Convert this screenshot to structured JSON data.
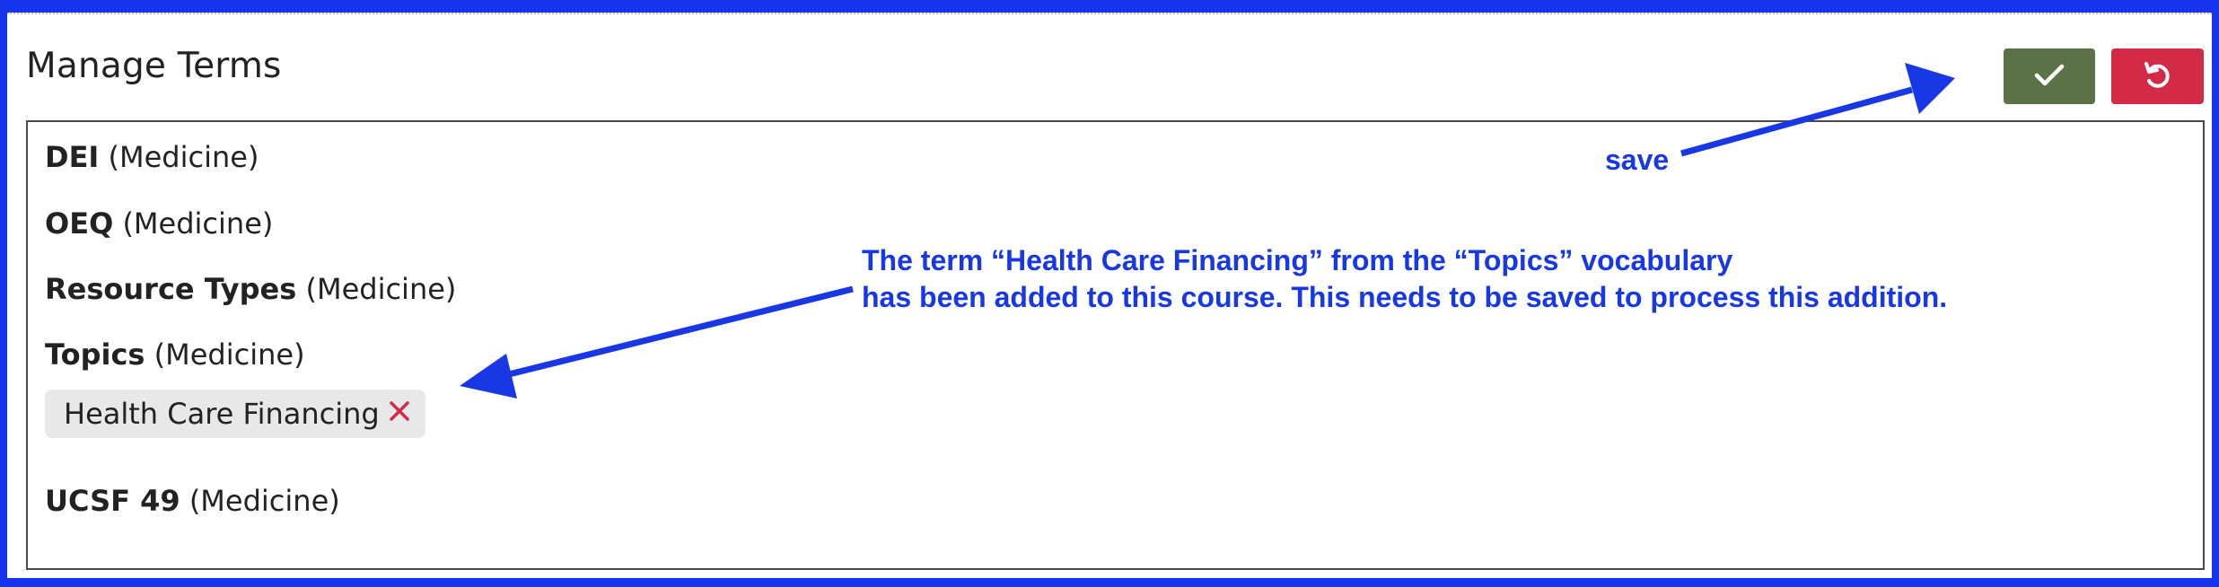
{
  "header": {
    "title": "Manage Terms",
    "save_icon": "check-icon",
    "cancel_icon": "undo-icon"
  },
  "vocabularies": [
    {
      "name": "DEI",
      "school": "(Medicine)"
    },
    {
      "name": "OEQ",
      "school": "(Medicine)"
    },
    {
      "name": "Resource Types",
      "school": "(Medicine)"
    },
    {
      "name": "Topics",
      "school": "(Medicine)"
    },
    {
      "name": "UCSF 49",
      "school": "(Medicine)"
    }
  ],
  "selected_terms": {
    "topics": [
      {
        "label": "Health Care Financing",
        "remove_icon": "close-icon"
      }
    ]
  },
  "annotations": {
    "save_label": "save",
    "note_line1": "The term “Health Care Financing” from the “Topics” vocabulary",
    "note_line2": "has been added to this course. This needs to be saved to process this addition."
  },
  "colors": {
    "frame": "#1733ee",
    "save_button": "#5b7146",
    "cancel_button": "#d32b47",
    "annotation": "#1838e6",
    "tag_bg": "#e6e8ea",
    "remove_x": "#d32b47"
  }
}
